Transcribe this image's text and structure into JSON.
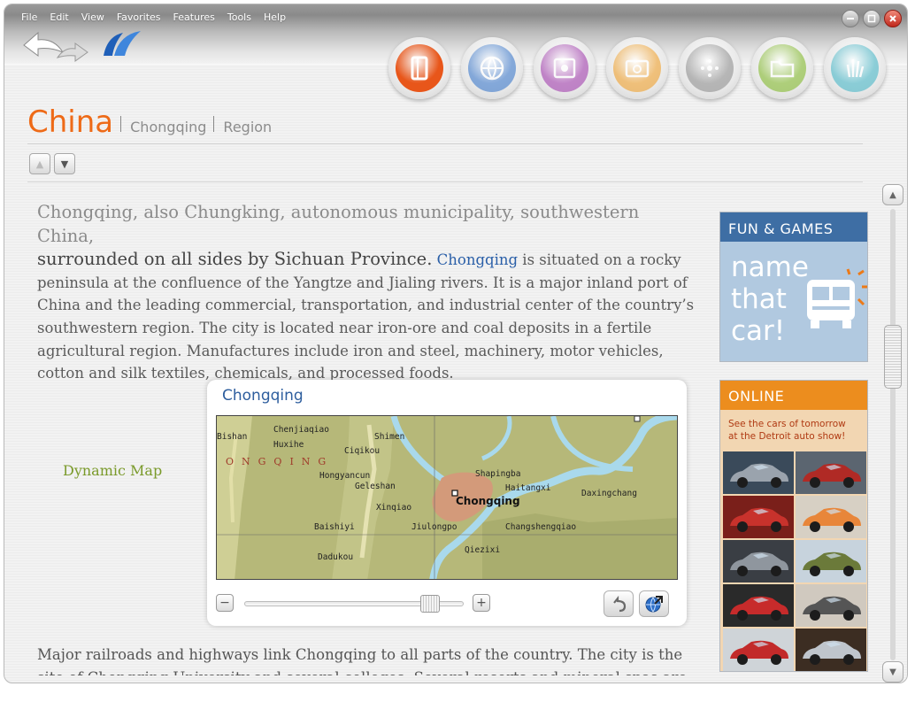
{
  "menu": [
    "File",
    "Edit",
    "View",
    "Favorites",
    "Features",
    "Tools",
    "Help"
  ],
  "nav_buttons": [
    {
      "name": "encyclopedia",
      "color": "#e8561a",
      "active": true
    },
    {
      "name": "world",
      "color": "#2d6fc8",
      "active": false
    },
    {
      "name": "media",
      "color": "#9b2fa8",
      "active": false
    },
    {
      "name": "photos",
      "color": "#f09a1c",
      "active": false
    },
    {
      "name": "gallery",
      "color": "#888888",
      "active": false
    },
    {
      "name": "folders",
      "color": "#7ab51d",
      "active": false
    },
    {
      "name": "hands",
      "color": "#3ab2c4",
      "active": false
    }
  ],
  "breadcrumb": {
    "title": "China",
    "items": [
      "Chongqing",
      "Region"
    ]
  },
  "article": {
    "lead_line1": "Chongqing, also Chungking, autonomous municipality, southwestern China,",
    "lead_line2": "surrounded on all sides by Sichuan Province.",
    "link": "Chongqing",
    "para1_rest": " is situated on a rocky peninsula at the confluence of the Yangtze and Jialing rivers. It is a major inland port of China and the leading commercial, transportation, and industrial center of the country’s southwestern region. The city is located near iron-ore and coal deposits in a fertile agricultural region. Manufactures include iron and steel, machinery, motor vehicles, cotton and silk textiles, chemicals, and processed foods.",
    "para2": "Major railroads and highways link Chongqing to all parts of the country. The city is the site of Chongqing University and several colleges. Several resorts and mineral spas are located in"
  },
  "dynamic_map_label": "Dynamic Map",
  "map": {
    "title": "Chongqing",
    "region_label": "ONGQING",
    "cities": {
      "chenjiaqiao": "Chenjiaqiao",
      "bishan": "Bishan",
      "huxihe": "Huxihe",
      "shimen": "Shimen",
      "ciqikou": "Ciqikou",
      "hongyancun": "Hongyancun",
      "geleshan": "Geleshan",
      "shapingba": "Shapingba",
      "haitangxi": "Haitangxi",
      "daxingchang": "Daxingchang",
      "chongqing": "Chongqing",
      "xinqiao": "Xinqiao",
      "baishiyi": "Baishiyi",
      "jiulongpo": "Jiulongpo",
      "changshengqiao": "Changshengqiao",
      "qiezixi": "Qiezixi",
      "dadukou": "Dadukou"
    },
    "zoom_percent": 88
  },
  "promos": {
    "fun_games": {
      "header": "FUN & GAMES",
      "line1": "name",
      "line2": "that",
      "line3": "car!"
    },
    "online": {
      "header": "ONLINE",
      "sub1": "See the cars of tomorrow",
      "sub2": "at the Detroit auto show!"
    }
  },
  "scroll": {
    "position_fraction": 0.3
  }
}
